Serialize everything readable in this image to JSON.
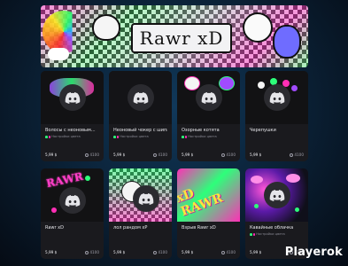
{
  "banner": {
    "title": "Rawr xD"
  },
  "currency_suffix": "$",
  "products": [
    {
      "title": "Волосы с неоновым...",
      "seller": "Настройки цвета",
      "price": "5,99 $",
      "sales": "4100",
      "art": "neon"
    },
    {
      "title": "Неоновый чокер с шипа",
      "seller": "Настройки цвета",
      "price": "5,99 $",
      "sales": "4100",
      "art": "plain"
    },
    {
      "title": "Озорные котята",
      "seller": "Настройки цвета",
      "price": "5,99 $",
      "sales": "4100",
      "art": "neon"
    },
    {
      "title": "Черепушки",
      "seller": "",
      "price": "5,99 $",
      "sales": "4100",
      "art": "neon"
    },
    {
      "title": "Rawr xD",
      "seller": "",
      "price": "5,99 $",
      "sales": "4100",
      "art": "rawr-neon"
    },
    {
      "title": "лол рандом xP",
      "seller": "",
      "price": "5,99 $",
      "sales": "4100",
      "art": "check"
    },
    {
      "title": "Взрыв Rawr xD",
      "seller": "",
      "price": "5,99 $",
      "sales": "4100",
      "art": "rawr"
    },
    {
      "title": "Кавайные облачка",
      "seller": "Настройки цвета",
      "price": "5,99 $",
      "sales": "4100",
      "art": "cloud"
    }
  ],
  "art_text": {
    "rawr_small": "RAWR",
    "rawr_big": "xD RAWR"
  },
  "watermark": "Playerok",
  "colors": {
    "accent_pink": "#ff2fb6",
    "accent_green": "#2dff7a",
    "card_bg": "#1a1a1e"
  }
}
